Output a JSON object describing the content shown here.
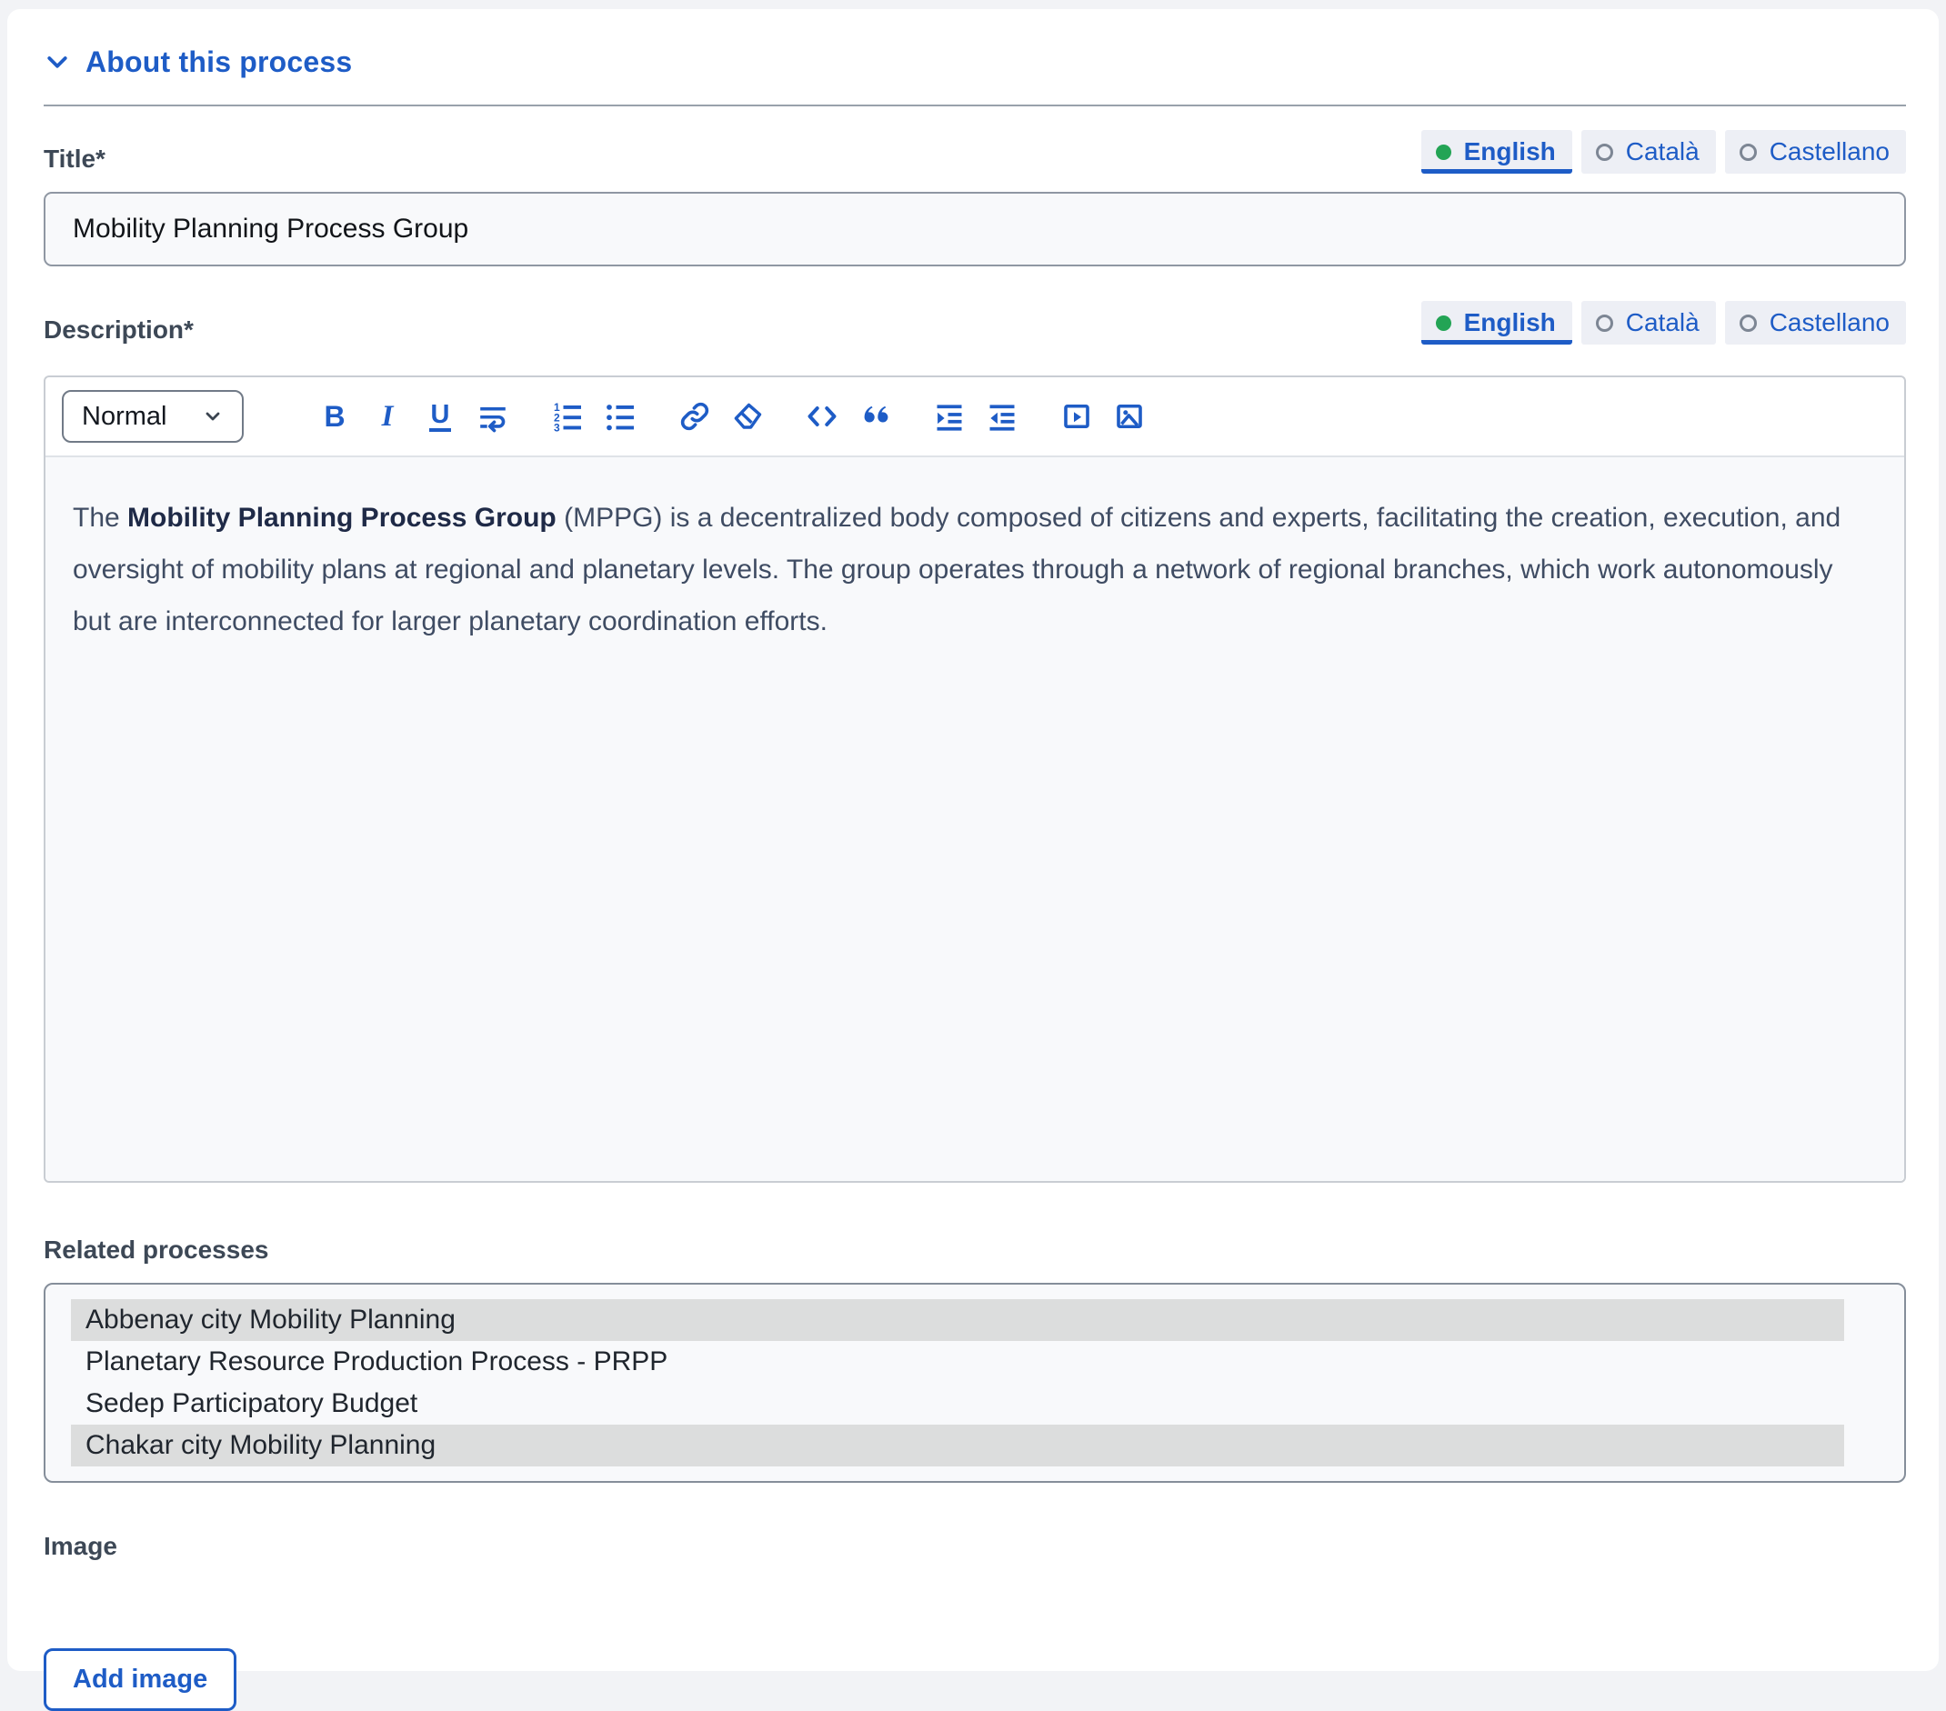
{
  "section": {
    "title": "About this process"
  },
  "language_tabs": {
    "options": [
      {
        "label": "English",
        "state": "active"
      },
      {
        "label": "Català",
        "state": "inactive"
      },
      {
        "label": "Castellano",
        "state": "inactive"
      }
    ]
  },
  "title_field": {
    "label": "Title*",
    "value": "Mobility Planning Process Group"
  },
  "description_field": {
    "label": "Description*",
    "toolbar": {
      "style_selector": "Normal",
      "icons": [
        "bold",
        "italic",
        "underline",
        "line-break",
        "ordered-list",
        "bullet-list",
        "link",
        "clear-formatting",
        "code",
        "blockquote",
        "indent",
        "outdent",
        "video",
        "image"
      ]
    },
    "text_before_bold": "The ",
    "bold_text": "Mobility Planning Process Group",
    "text_after_bold": " (MPPG) is a decentralized body composed of citizens and experts, facilitating the creation, execution, and oversight of mobility plans at regional and planetary levels. The group operates through a network of regional branches, which work autonomously but are interconnected for larger planetary coordination efforts."
  },
  "related_processes": {
    "label": "Related processes",
    "options": [
      {
        "label": "Abbenay city Mobility Planning",
        "selected": true
      },
      {
        "label": "Planetary Resource Production Process - PRPP",
        "selected": false
      },
      {
        "label": "Sedep Participatory Budget",
        "selected": false
      },
      {
        "label": "Chakar city Mobility Planning",
        "selected": true
      }
    ]
  },
  "image_field": {
    "label": "Image",
    "add_button_label": "Add image"
  },
  "colors": {
    "accent_blue": "#1e5cc6",
    "active_dot_green": "#23a455",
    "selected_option_bg": "#dcdddd",
    "page_background": "#f2f3f6"
  }
}
